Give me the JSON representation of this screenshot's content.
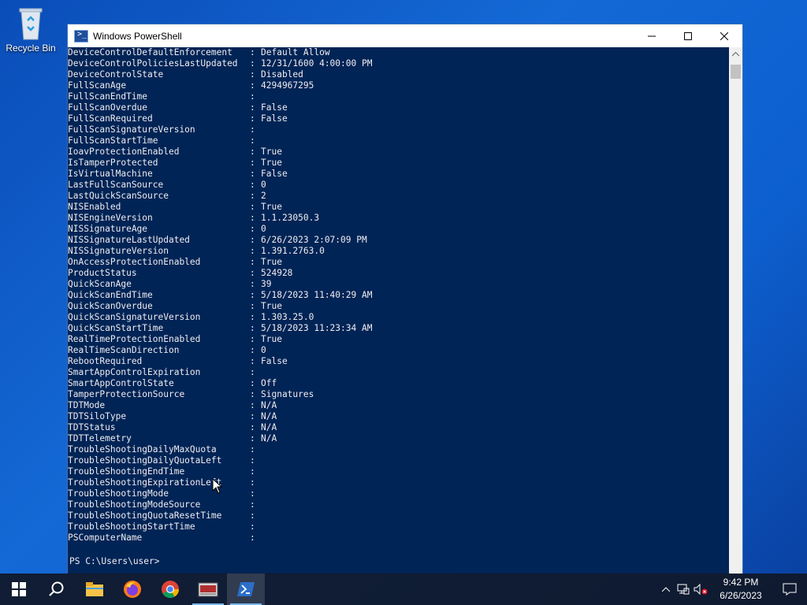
{
  "desktop": {
    "recycle_bin_label": "Recycle Bin"
  },
  "window": {
    "title": "Windows PowerShell",
    "icon": "powershell-icon",
    "controls": [
      "minimize-icon",
      "maximize-icon",
      "close-icon"
    ]
  },
  "console": {
    "lines": [
      {
        "key": "DeviceControlDefaultEnforcement",
        "value": "Default Allow"
      },
      {
        "key": "DeviceControlPoliciesLastUpdated",
        "value": "12/31/1600 4:00:00 PM"
      },
      {
        "key": "DeviceControlState",
        "value": "Disabled"
      },
      {
        "key": "FullScanAge",
        "value": "4294967295"
      },
      {
        "key": "FullScanEndTime",
        "value": ""
      },
      {
        "key": "FullScanOverdue",
        "value": "False"
      },
      {
        "key": "FullScanRequired",
        "value": "False"
      },
      {
        "key": "FullScanSignatureVersion",
        "value": ""
      },
      {
        "key": "FullScanStartTime",
        "value": ""
      },
      {
        "key": "IoavProtectionEnabled",
        "value": "True"
      },
      {
        "key": "IsTamperProtected",
        "value": "True"
      },
      {
        "key": "IsVirtualMachine",
        "value": "False"
      },
      {
        "key": "LastFullScanSource",
        "value": "0"
      },
      {
        "key": "LastQuickScanSource",
        "value": "2"
      },
      {
        "key": "NISEnabled",
        "value": "True"
      },
      {
        "key": "NISEngineVersion",
        "value": "1.1.23050.3"
      },
      {
        "key": "NISSignatureAge",
        "value": "0"
      },
      {
        "key": "NISSignatureLastUpdated",
        "value": "6/26/2023 2:07:09 PM"
      },
      {
        "key": "NISSignatureVersion",
        "value": "1.391.2763.0"
      },
      {
        "key": "OnAccessProtectionEnabled",
        "value": "True"
      },
      {
        "key": "ProductStatus",
        "value": "524928"
      },
      {
        "key": "QuickScanAge",
        "value": "39"
      },
      {
        "key": "QuickScanEndTime",
        "value": "5/18/2023 11:40:29 AM"
      },
      {
        "key": "QuickScanOverdue",
        "value": "True"
      },
      {
        "key": "QuickScanSignatureVersion",
        "value": "1.303.25.0"
      },
      {
        "key": "QuickScanStartTime",
        "value": "5/18/2023 11:23:34 AM"
      },
      {
        "key": "RealTimeProtectionEnabled",
        "value": "True"
      },
      {
        "key": "RealTimeScanDirection",
        "value": "0"
      },
      {
        "key": "RebootRequired",
        "value": "False"
      },
      {
        "key": "SmartAppControlExpiration",
        "value": ""
      },
      {
        "key": "SmartAppControlState",
        "value": "Off"
      },
      {
        "key": "TamperProtectionSource",
        "value": "Signatures"
      },
      {
        "key": "TDTMode",
        "value": "N/A"
      },
      {
        "key": "TDTSiloType",
        "value": "N/A"
      },
      {
        "key": "TDTStatus",
        "value": "N/A"
      },
      {
        "key": "TDTTelemetry",
        "value": "N/A"
      },
      {
        "key": "TroubleShootingDailyMaxQuota",
        "value": ""
      },
      {
        "key": "TroubleShootingDailyQuotaLeft",
        "value": ""
      },
      {
        "key": "TroubleShootingEndTime",
        "value": ""
      },
      {
        "key": "TroubleShootingExpirationLeft",
        "value": ""
      },
      {
        "key": "TroubleShootingMode",
        "value": ""
      },
      {
        "key": "TroubleShootingModeSource",
        "value": ""
      },
      {
        "key": "TroubleShootingQuotaResetTime",
        "value": ""
      },
      {
        "key": "TroubleShootingStartTime",
        "value": ""
      },
      {
        "key": "PSComputerName",
        "value": ""
      }
    ],
    "prompt": "PS C:\\Users\\user> "
  },
  "taskbar": {
    "apps": [
      "start-icon",
      "search-icon",
      "file-explorer-icon",
      "firefox-icon",
      "chrome-icon",
      "app-icon",
      "powershell-icon"
    ],
    "clock_time": "9:42 PM",
    "clock_date": "6/26/2023"
  }
}
